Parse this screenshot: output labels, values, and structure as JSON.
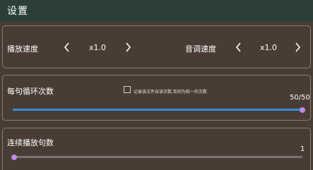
{
  "header": {
    "title": "设置"
  },
  "speed": {
    "play_label": "播放速度",
    "play_value": "x1.0",
    "pitch_label": "音调速度",
    "pitch_value": "x1.0"
  },
  "loop": {
    "label": "每句循环次数",
    "checkbox_label": "记录该文件自读次数,否则为统一的次数",
    "checked": false,
    "count_text": "50/50",
    "value": 50,
    "max": 50
  },
  "continuous": {
    "label": "连续播放句数",
    "count_text": "1",
    "value": 1,
    "min": 1
  },
  "colors": {
    "header_bg": "#2b3f37",
    "bg": "#493c35",
    "slider_fill": "#2f8fe0",
    "slider_thumb": "#c08be8"
  },
  "icons": {
    "prev": "chevron-left-icon",
    "next": "chevron-right-icon"
  }
}
